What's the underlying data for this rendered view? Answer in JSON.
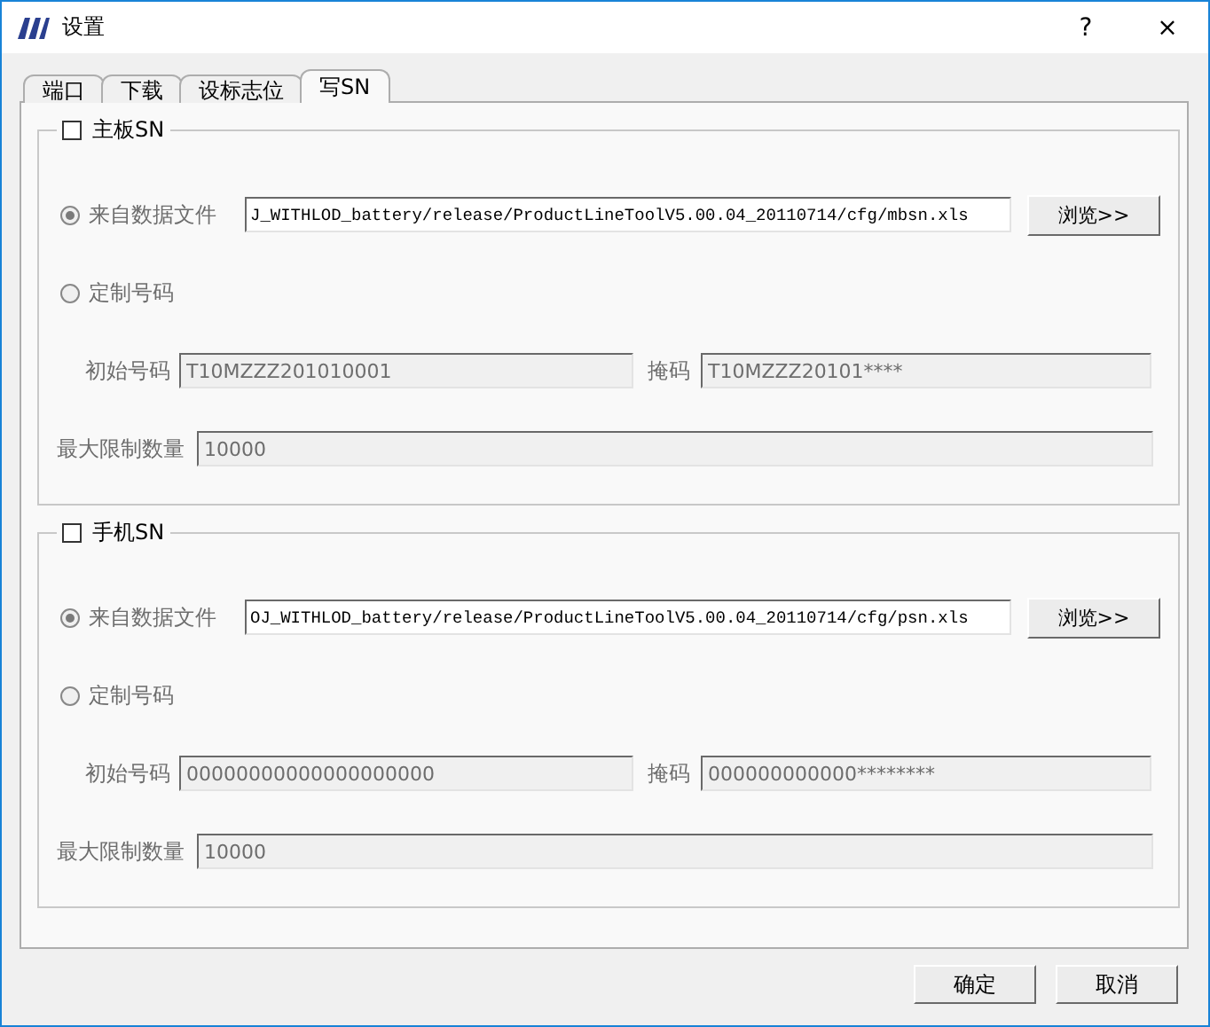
{
  "window": {
    "title": "设置",
    "help": "?",
    "close": "×"
  },
  "tabs": [
    {
      "label": "端口",
      "selected": false
    },
    {
      "label": "下载",
      "selected": false
    },
    {
      "label": "设标志位",
      "selected": false
    },
    {
      "label": "写SN",
      "selected": true
    }
  ],
  "groups": [
    {
      "label": "主板SN",
      "checked": false,
      "disabled": true,
      "source": {
        "label": "来自数据文件",
        "selected": true,
        "path": "J_WITHLOD_battery/release/ProductLineToolV5.00.04_20110714/cfg/mbsn.xls",
        "browse": "浏览>>"
      },
      "custom": {
        "label": "定制号码",
        "selected": false
      },
      "start": {
        "label": "初始号码",
        "value": "T10MZZZ201010001"
      },
      "mask": {
        "label": "掩码",
        "value": "T10MZZZ20101****"
      },
      "max": {
        "label": "最大限制数量",
        "value": "10000"
      }
    },
    {
      "label": "手机SN",
      "checked": false,
      "disabled": true,
      "source": {
        "label": "来自数据文件",
        "selected": true,
        "path": "OJ_WITHLOD_battery/release/ProductLineToolV5.00.04_20110714/cfg/psn.xls",
        "browse": "浏览>>"
      },
      "custom": {
        "label": "定制号码",
        "selected": false
      },
      "start": {
        "label": "初始号码",
        "value": "00000000000000000000"
      },
      "mask": {
        "label": "掩码",
        "value": "000000000000********"
      },
      "max": {
        "label": "最大限制数量",
        "value": "10000"
      }
    }
  ],
  "buttons": [
    "确定",
    "取消"
  ]
}
